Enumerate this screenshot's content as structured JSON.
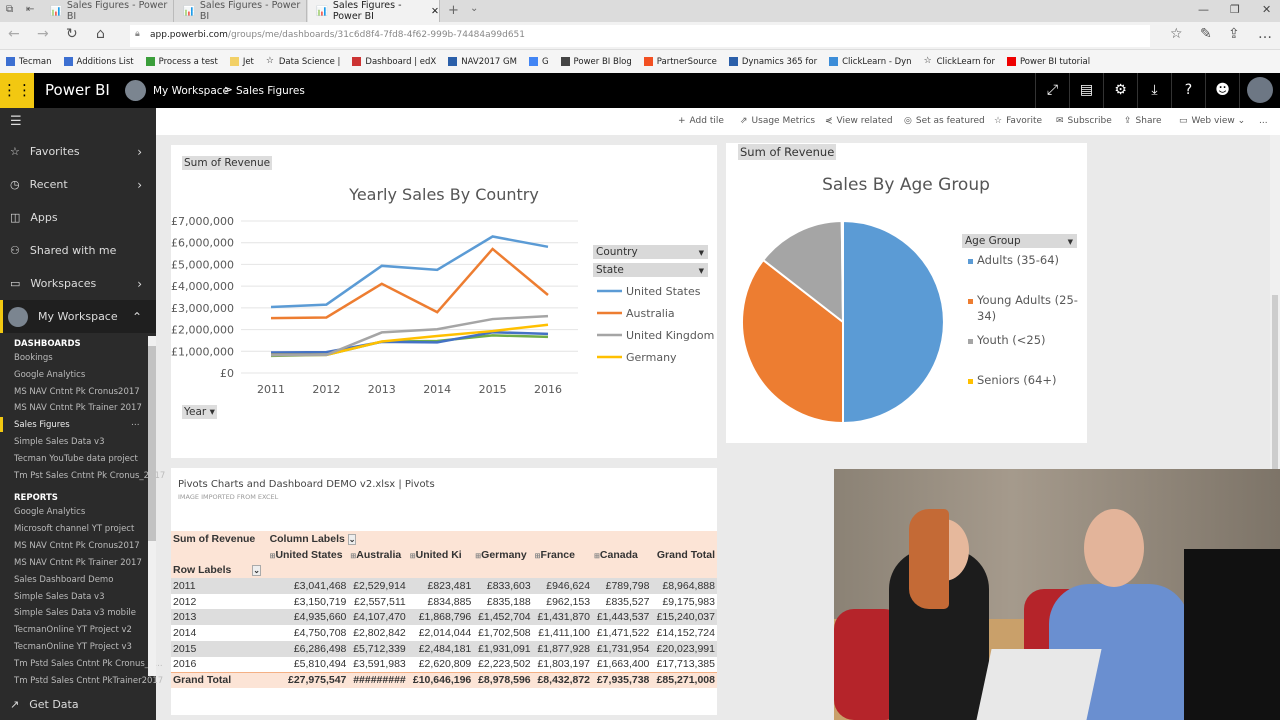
{
  "browser": {
    "tabs": [
      "Sales Figures - Power BI",
      "Sales Figures - Power BI",
      "Sales Figures - Power BI"
    ],
    "url_host": "app.powerbi.com",
    "url_path": "/groups/me/dashboards/31c6d8f4-7fd8-4f62-999b-74484a99d651",
    "bookmarks": [
      "Tecman",
      "Additions List",
      "Process a test",
      "Jet",
      "Data Science |",
      "Dashboard | edX",
      "NAV2017 GM",
      "G",
      "Power BI Blog",
      "PartnerSource",
      "Dynamics 365 for",
      "ClickLearn - Dyn",
      "ClickLearn for",
      "Power BI tutorial"
    ]
  },
  "header": {
    "app": "Power BI",
    "workspace": "My Workspace",
    "separator": ">",
    "page": "Sales Figures"
  },
  "sidebar": {
    "items": [
      {
        "label": "Favorites"
      },
      {
        "label": "Recent"
      },
      {
        "label": "Apps"
      },
      {
        "label": "Shared with me"
      },
      {
        "label": "Workspaces"
      },
      {
        "label": "My Workspace"
      }
    ],
    "dashboards_heading": "DASHBOARDS",
    "dashboards": [
      "Bookings",
      "Google Analytics",
      "MS NAV Cntnt Pk Cronus2017",
      "MS NAV Cntnt Pk Trainer 2017",
      "Sales Figures",
      "Simple Sales Data v3",
      "Tecman YouTube data project",
      "Tm Pst Sales Cntnt Pk Cronus_2017"
    ],
    "reports_heading": "REPORTS",
    "reports": [
      "Google Analytics",
      "Microsoft channel YT project",
      "MS NAV Cntnt Pk Cronus2017",
      "MS NAV Cntnt Pk Trainer 2017",
      "Sales Dashboard Demo",
      "Simple Sales Data v3",
      "Simple Sales Data v3 mobile",
      "TecmanOnline YT Project v2",
      "TecmanOnline YT Project v3",
      "Tm Pstd Sales Cntnt Pk Cronus_2...",
      "Tm Pstd Sales Cntnt PkTrainer2017"
    ],
    "get_data": "Get Data",
    "more": "..."
  },
  "actions": [
    "Add tile",
    "Usage Metrics",
    "View related",
    "Set as featured",
    "Favorite",
    "Subscribe",
    "Share",
    "Web view",
    "..."
  ],
  "chart_data": [
    {
      "type": "line",
      "title": "Yearly Sales By Country",
      "field_chip": "Sum of Revenue",
      "axis_chip": "Year",
      "legend_filters": [
        "Country",
        "State"
      ],
      "legend": "right",
      "categories": [
        "2011",
        "2012",
        "2013",
        "2014",
        "2015",
        "2016"
      ],
      "ylim": [
        0,
        7000000
      ],
      "yticks": [
        "£0",
        "£1,000,000",
        "£2,000,000",
        "£3,000,000",
        "£4,000,000",
        "£5,000,000",
        "£6,000,000",
        "£7,000,000"
      ],
      "series": [
        {
          "name": "United States",
          "color": "#5b9bd5",
          "values": [
            3041468,
            3150719,
            4935660,
            4750708,
            6286498,
            5810494
          ]
        },
        {
          "name": "Australia",
          "color": "#ed7d31",
          "values": [
            2529914,
            2557511,
            4107470,
            2802842,
            5712339,
            3591983
          ]
        },
        {
          "name": "United Kingdom",
          "color": "#a5a5a5",
          "values": [
            823481,
            834885,
            1868796,
            2014044,
            2484181,
            2620809
          ]
        },
        {
          "name": "Germany",
          "color": "#ffc000",
          "values": [
            833603,
            835188,
            1452704,
            1702508,
            1931091,
            2223502
          ]
        },
        {
          "color": "#4472c4",
          "values": [
            946624,
            962153,
            1431870,
            1411100,
            1877928,
            1803197
          ]
        },
        {
          "color": "#70ad47",
          "values": [
            789798,
            835527,
            1443537,
            1471522,
            1731954,
            1663400
          ]
        }
      ]
    },
    {
      "type": "pie",
      "title": "Sales By Age Group",
      "field_chip": "Sum of Revenue",
      "legend_title": "Age Group",
      "legend": "right",
      "slices": [
        {
          "name": "Adults (35-64)",
          "color": "#5b9bd5",
          "value": 50
        },
        {
          "name": "Young Adults (25-34)",
          "color": "#ed7d31",
          "value": 35.5
        },
        {
          "name": "Youth (<25)",
          "color": "#a5a5a5",
          "value": 14.3
        },
        {
          "name": "Seniors (64+)",
          "color": "#ffc000",
          "value": 0.2
        }
      ]
    }
  ],
  "pivot": {
    "title": "Pivots Charts and Dashboard DEMO v2.xlsx | Pivots",
    "subtitle": "IMAGE IMPORTED FROM EXCEL",
    "corner": "Sum of Revenue",
    "column_labels": "Column Labels",
    "row_labels": "Row Labels",
    "columns": [
      "United States",
      "Australia",
      "United Ki",
      "Germany",
      "France",
      "Canada",
      "Grand Total"
    ],
    "rows": [
      {
        "label": "2011",
        "values": [
          "£3,041,468",
          "£2,529,914",
          "£823,481",
          "£833,603",
          "£946,624",
          "£789,798",
          "£8,964,888"
        ]
      },
      {
        "label": "2012",
        "values": [
          "£3,150,719",
          "£2,557,511",
          "£834,885",
          "£835,188",
          "£962,153",
          "£835,527",
          "£9,175,983"
        ]
      },
      {
        "label": "2013",
        "values": [
          "£4,935,660",
          "£4,107,470",
          "£1,868,796",
          "£1,452,704",
          "£1,431,870",
          "£1,443,537",
          "£15,240,037"
        ]
      },
      {
        "label": "2014",
        "values": [
          "£4,750,708",
          "£2,802,842",
          "£2,014,044",
          "£1,702,508",
          "£1,411,100",
          "£1,471,522",
          "£14,152,724"
        ]
      },
      {
        "label": "2015",
        "values": [
          "£6,286,498",
          "£5,712,339",
          "£2,484,181",
          "£1,931,091",
          "£1,877,928",
          "£1,731,954",
          "£20,023,991"
        ]
      },
      {
        "label": "2016",
        "values": [
          "£5,810,494",
          "£3,591,983",
          "£2,620,809",
          "£2,223,502",
          "£1,803,197",
          "£1,663,400",
          "£17,713,385"
        ]
      }
    ],
    "total": {
      "label": "Grand Total",
      "values": [
        "£27,975,547",
        "#########",
        "£10,646,196",
        "£8,978,596",
        "£8,432,872",
        "£7,935,738",
        "£85,271,008"
      ]
    }
  }
}
